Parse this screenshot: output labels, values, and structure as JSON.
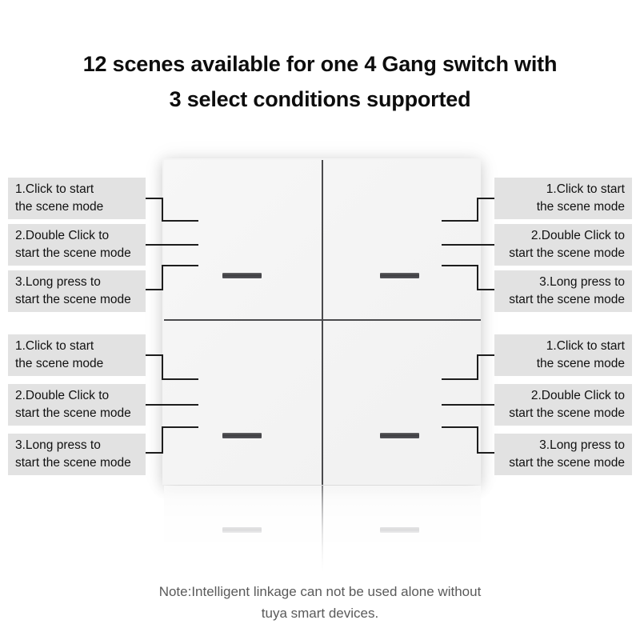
{
  "title": {
    "line1": "12 scenes available for one 4 Gang switch with",
    "line2": "3 select conditions supported"
  },
  "note": {
    "line1": "Note:Intelligent linkage can not be used alone without",
    "line2": "tuya smart devices."
  },
  "colors": {
    "label_background": "#e2e2e2",
    "label_text": "#111111",
    "panel_face": "#f4f4f4",
    "panel_divider": "#4a4a4d",
    "indicator": "#3f3f42",
    "note_text": "#5a5a5a",
    "title_text": "#0d0d0d"
  },
  "callouts": {
    "top_left": [
      {
        "line1": "1.Click to start",
        "line2": "the scene mode"
      },
      {
        "line1": "2.Double Click to",
        "line2": "start the scene mode"
      },
      {
        "line1": "3.Long press to",
        "line2": "start the scene mode"
      }
    ],
    "bottom_left": [
      {
        "line1": "1.Click to start",
        "line2": "the scene mode"
      },
      {
        "line1": "2.Double Click to",
        "line2": "start the scene mode"
      },
      {
        "line1": "3.Long press to",
        "line2": "start the scene mode"
      }
    ],
    "top_right": [
      {
        "line1": "1.Click to start",
        "line2": "the scene mode"
      },
      {
        "line1": "2.Double Click to",
        "line2": "start the scene mode"
      },
      {
        "line1": "3.Long press to",
        "line2": "start the scene mode"
      }
    ],
    "bottom_right": [
      {
        "line1": "1.Click to start",
        "line2": "the scene mode"
      },
      {
        "line1": "2.Double Click to",
        "line2": "start the scene mode"
      },
      {
        "line1": "3.Long press to",
        "line2": "start the scene mode"
      }
    ]
  },
  "switch": {
    "gangs": 4,
    "gang_labels": [
      "top-left-gang",
      "top-right-gang",
      "bottom-left-gang",
      "bottom-right-gang"
    ],
    "indicator_name": "indicator-bar"
  }
}
